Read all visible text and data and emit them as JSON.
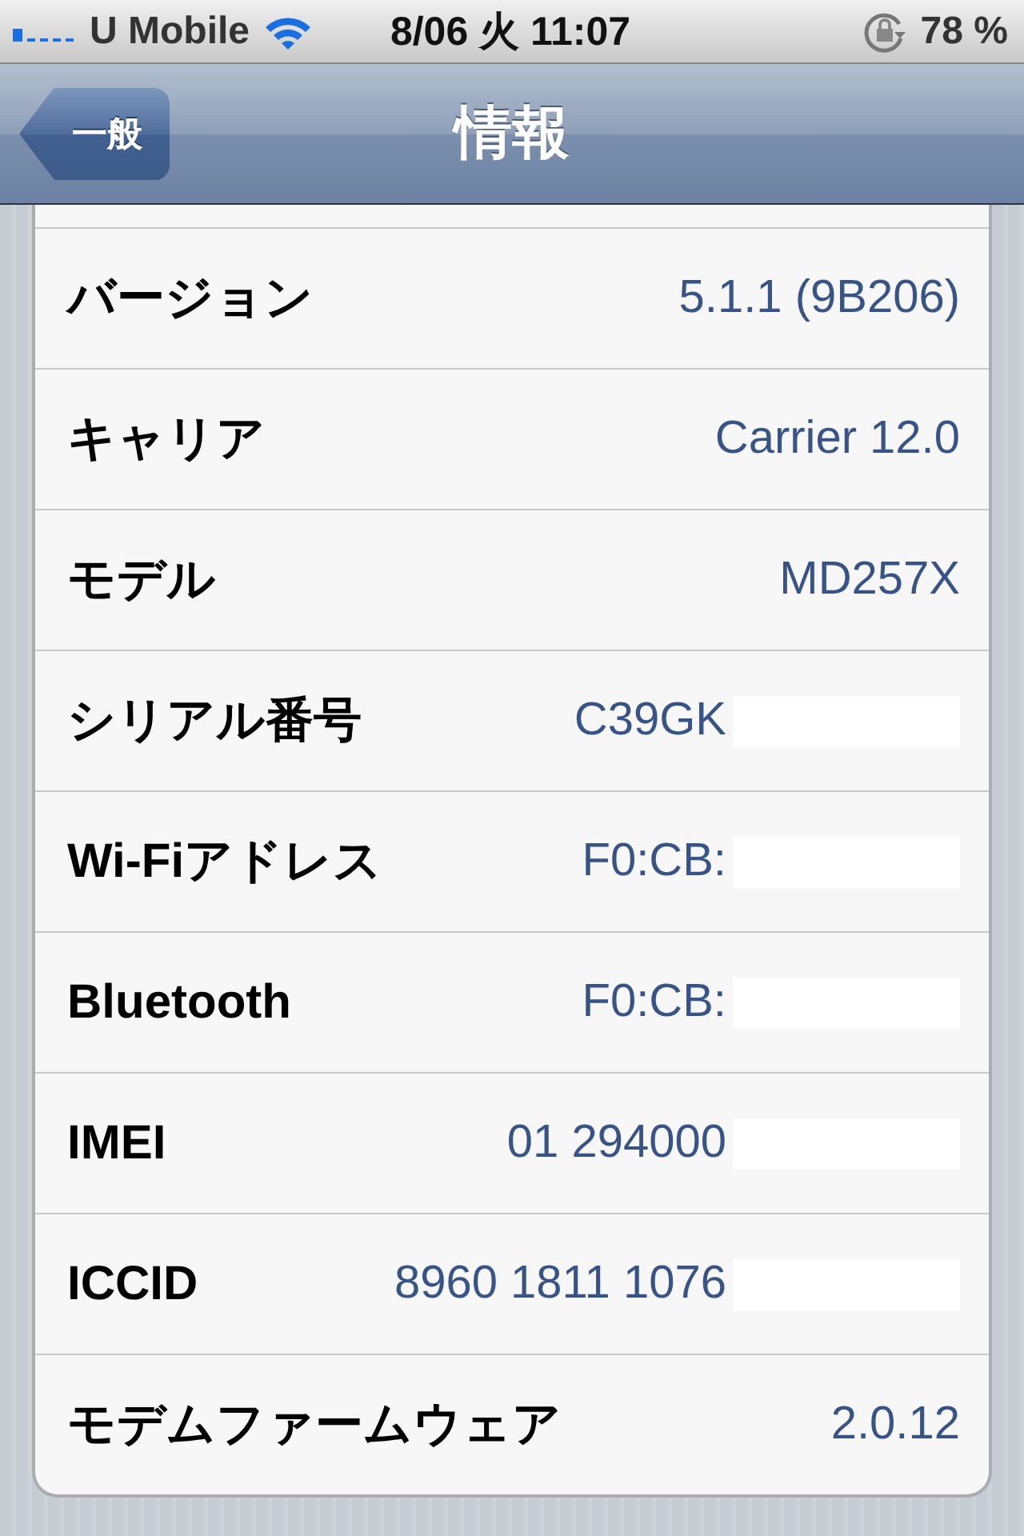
{
  "status_bar": {
    "carrier": "U Mobile",
    "time": "8/06 火 11:07",
    "battery": "78 %"
  },
  "nav_bar": {
    "back": "一般",
    "title": "情報"
  },
  "rows": [
    {
      "label": "バージョン",
      "value": "5.1.1 (9B206)",
      "redacted": false
    },
    {
      "label": "キャリア",
      "value": "Carrier 12.0",
      "redacted": false
    },
    {
      "label": "モデル",
      "value": "MD257X",
      "redacted": false
    },
    {
      "label": "シリアル番号",
      "value": "C39GK",
      "redacted": true
    },
    {
      "label": "Wi-Fiアドレス",
      "value": "F0:CB:",
      "redacted": true
    },
    {
      "label": "Bluetooth",
      "value": "F0:CB:",
      "redacted": true
    },
    {
      "label": "IMEI",
      "value": "01 294000",
      "redacted": true
    },
    {
      "label": "ICCID",
      "value": "8960 1811 1076",
      "redacted": true
    },
    {
      "label": "モデムファームウェア",
      "value": "2.0.12",
      "redacted": false
    }
  ]
}
